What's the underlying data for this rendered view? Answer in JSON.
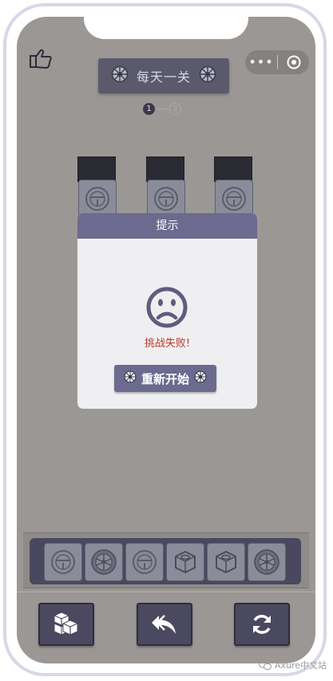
{
  "header": {
    "title": "每天一关",
    "steps": [
      "1",
      "2"
    ],
    "current_step": 1
  },
  "capsule": {
    "more_icon": "more-dots-icon",
    "close_icon": "target-icon"
  },
  "back_icon": "thumb-back-icon",
  "board": {
    "targets": [
      "steering-wheel",
      "steering-wheel",
      "steering-wheel"
    ],
    "tiles": [
      "steering-wheel",
      "steering-wheel",
      "steering-wheel"
    ]
  },
  "dialog": {
    "title": "提示",
    "message": "挑战失败!",
    "restart_label": "重新开始",
    "icon": "sad-face-icon"
  },
  "tray": {
    "items": [
      "steering-wheel",
      "wheel-rim",
      "steering-wheel",
      "hex-nut",
      "hex-nut",
      "wheel-rim"
    ]
  },
  "controls": [
    "cubes-icon",
    "undo-icon",
    "refresh-icon"
  ],
  "watermark": {
    "text": "Axure中文站"
  },
  "colors": {
    "screen_bg": "#9b9794",
    "accent": "#6d6a8f",
    "dark_button": "#4a4960",
    "fail_text": "#b83a2a"
  }
}
